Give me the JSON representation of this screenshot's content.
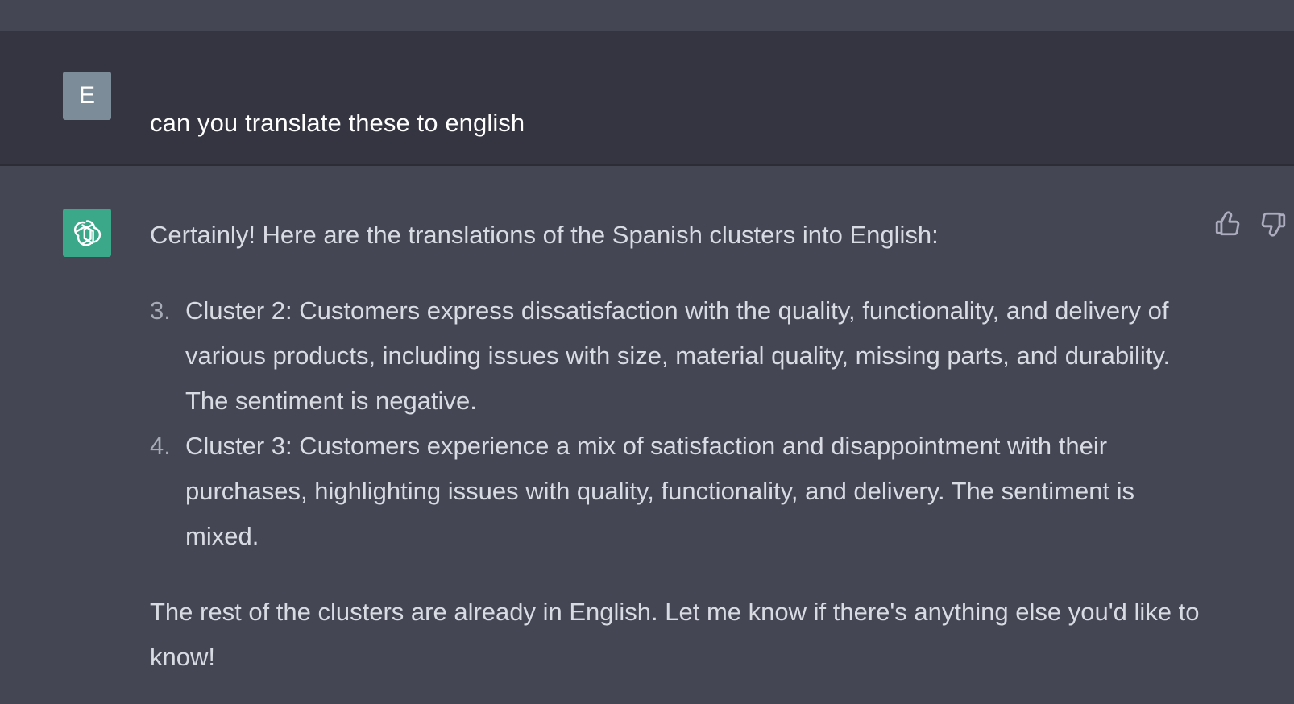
{
  "user_message": {
    "avatar_letter": "E",
    "text": "can you translate these to english"
  },
  "assistant_message": {
    "avatar_icon": "openai-logo-icon",
    "intro": "Certainly! Here are the translations of the Spanish clusters into English:",
    "items": [
      {
        "number": "3.",
        "text": "Cluster 2: Customers express dissatisfaction with the quality, functionality, and delivery of various products, including issues with size, material quality, missing parts, and durability. The sentiment is negative."
      },
      {
        "number": "4.",
        "text": "Cluster 3: Customers experience a mix of satisfaction and disappointment with their purchases, highlighting issues with quality, functionality, and delivery. The sentiment is mixed."
      }
    ],
    "closing": "The rest of the clusters are already in English. Let me know if there's anything else you'd like to know!",
    "feedback_icons": [
      "thumbs-up-icon",
      "thumbs-down-icon"
    ]
  },
  "colors": {
    "background": "#444654",
    "user_row_background": "#343541",
    "user_avatar": "#7d8c99",
    "assistant_avatar": "#3aa889",
    "text": "#d9dbe3"
  }
}
